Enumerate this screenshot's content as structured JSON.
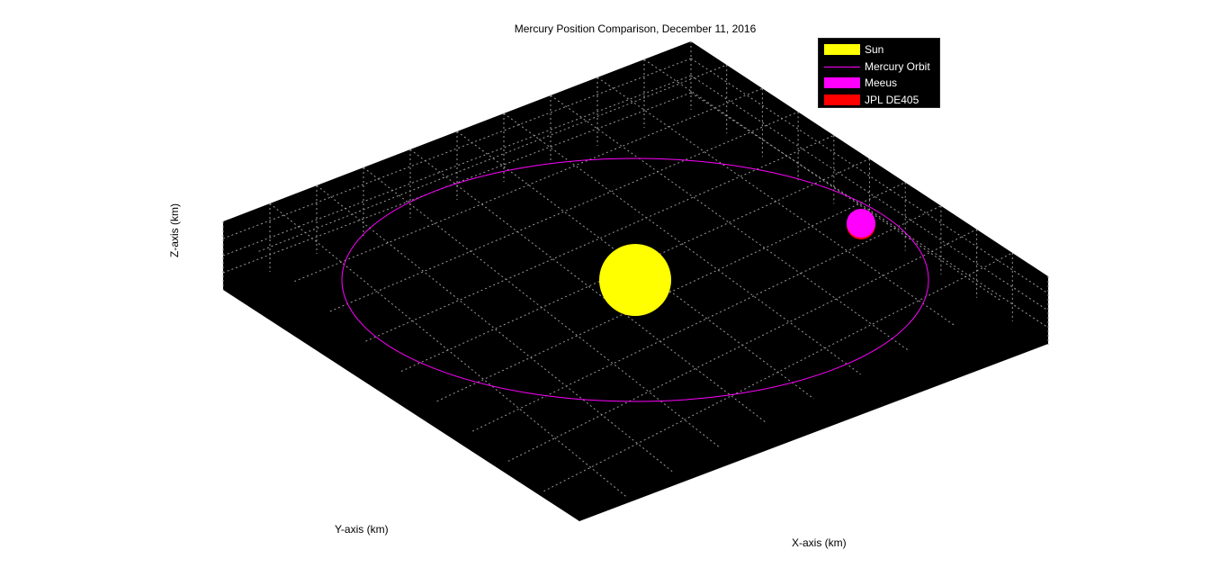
{
  "chart_data": {
    "type": "scatter",
    "title": "Mercury Position Comparison, December 11, 2016",
    "xlabel": "X-axis (km)",
    "ylabel": "Y-axis (km)",
    "zlabel": "Z-axis (km)",
    "background": "#000000",
    "grid": true,
    "legend_position": "top-right",
    "legend": [
      {
        "label": "Sun",
        "color": "#ffff00",
        "kind": "patch"
      },
      {
        "label": "Mercury Orbit",
        "color": "#ff00ff",
        "kind": "line"
      },
      {
        "label": "Meeus",
        "color": "#ff00ff",
        "kind": "patch"
      },
      {
        "label": "JPL DE405",
        "color": "#ff0000",
        "kind": "patch"
      }
    ]
  }
}
